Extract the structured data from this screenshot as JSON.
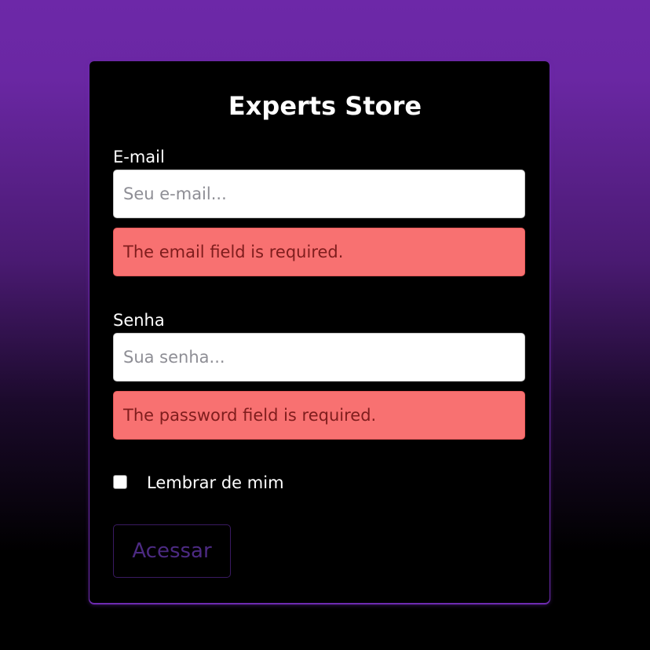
{
  "app": {
    "title": "Experts Store"
  },
  "form": {
    "email": {
      "label": "E-mail",
      "placeholder": "Seu e-mail...",
      "value": "",
      "error": "The email field is required."
    },
    "password": {
      "label": "Senha",
      "placeholder": "Sua senha...",
      "value": "",
      "error": "The password field is required."
    },
    "remember": {
      "label": "Lembrar de mim",
      "checked": false
    },
    "submit_label": "Acessar"
  },
  "colors": {
    "card_background": "#000000",
    "accent": "#6e2bb0",
    "error_background": "#f87171",
    "error_text": "#7f1d1d",
    "button_text": "#4c2a82"
  }
}
